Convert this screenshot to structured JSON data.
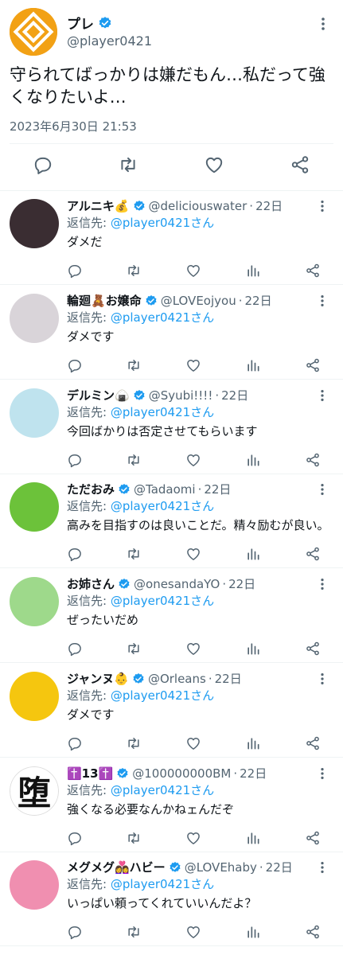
{
  "tweet": {
    "name": "プレ",
    "handle": "@player0421",
    "text": "守られてばっかりは嫌だもん…私だって強くなりたいよ…",
    "timestamp": "2023年6月30日 21:53"
  },
  "colors": {
    "accent": "#1d9bf0",
    "muted": "#536471",
    "avatar_main": "#f2a115"
  },
  "replies": [
    {
      "name": "アルニキ💰",
      "handle": "@deliciouswater",
      "time": "22日",
      "reply_label": "返信先:",
      "reply_to": "@player0421さん",
      "text": "ダメだ",
      "avatar_color": "#3a2d32"
    },
    {
      "name": "輪廻🧸お嬢命",
      "handle": "@LOVEojyou",
      "time": "22日",
      "reply_label": "返信先:",
      "reply_to": "@player0421さん",
      "text": "ダメです",
      "avatar_color": "#d9d4d9"
    },
    {
      "name": "デルミン🍙",
      "handle": "@Syubi!!!!",
      "time": "22日",
      "reply_label": "返信先:",
      "reply_to": "@player0421さん",
      "text": "今回ばかりは否定させてもらいます",
      "avatar_color": "#bfe3ee"
    },
    {
      "name": "ただおみ",
      "handle": "@Tadaomi",
      "time": "22日",
      "reply_label": "返信先:",
      "reply_to": "@player0421さん",
      "text": "高みを目指すのは良いことだ。精々励むが良い。",
      "avatar_color": "#6cc23a"
    },
    {
      "name": "お姉さん",
      "handle": "@onesandaYO",
      "time": "22日",
      "reply_label": "返信先:",
      "reply_to": "@player0421さん",
      "text": "ぜったいだめ",
      "avatar_color": "#9ed98b"
    },
    {
      "name": "ジャンヌ👶",
      "handle": "@Orleans",
      "time": "22日",
      "reply_label": "返信先:",
      "reply_to": "@player0421さん",
      "text": "ダメです",
      "avatar_color": "#f5c60f"
    },
    {
      "name": "✝️13✝️",
      "handle": "@100000000BM",
      "time": "22日",
      "reply_label": "返信先:",
      "reply_to": "@player0421さん",
      "text": "強くなる必要なんかねェんだぞ",
      "avatar_color": "#ffffff",
      "avatar_glyph": "堕"
    },
    {
      "name": "メグメグ👩‍❤️‍👩ハビー",
      "handle": "@LOVEhaby",
      "time": "22日",
      "reply_label": "返信先:",
      "reply_to": "@player0421さん",
      "text": "いっぱい頼ってくれていいんだよ？",
      "avatar_color": "#f08fb0"
    }
  ]
}
